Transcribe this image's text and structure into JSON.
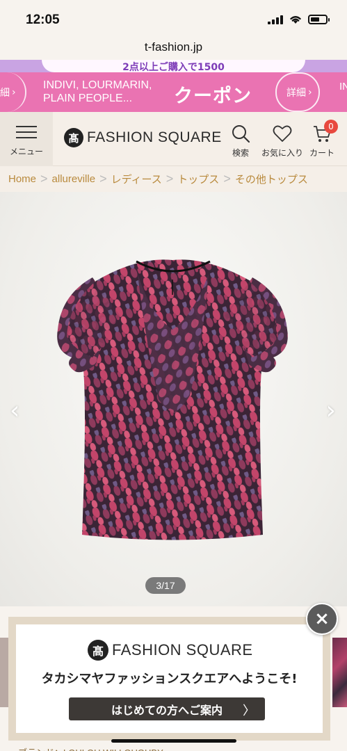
{
  "status": {
    "time": "12:05"
  },
  "browser": {
    "url": "t-fashion.jp"
  },
  "promo_top": {
    "text": "2点以上ご購入で1500"
  },
  "coupon": {
    "left_label": "細",
    "brands_line1": "INDIVI, LOURMARIN,",
    "brands_line2": "PLAIN PEOPLE...",
    "title": "クーポン",
    "detail": "詳細",
    "right_label": "IN"
  },
  "header": {
    "menu_label": "メニュー",
    "logo_mark": "髙",
    "logo_text": "FASHION SQUARE",
    "search_label": "検索",
    "favorites_label": "お気に入り",
    "cart_label": "カート",
    "cart_count": "0"
  },
  "breadcrumb": [
    "Home",
    "allureville",
    "レディース",
    "トップス",
    "その他トップス"
  ],
  "gallery": {
    "counter": "3/17",
    "prev": "‹",
    "next": "›"
  },
  "welcome": {
    "logo_mark": "髙",
    "logo_text": "FASHION SQUARE",
    "message": "タカシマヤファッションスクエアへようこそ!",
    "button": "はじめての方へご案内",
    "button_chevron": "〉"
  },
  "close": "×",
  "brand_line": "ブランド：LOULOU WILLOUGHBY",
  "colors": {
    "coupon_pink": "#ea73b2",
    "crumb_gold": "#b98a3d",
    "badge_red": "#e8493f",
    "promo_purple": "#c9a4e3"
  },
  "icons": [
    "hamburger-icon",
    "search-icon",
    "heart-icon",
    "cart-icon",
    "wifi-icon",
    "battery-icon",
    "signal-icon",
    "close-icon"
  ]
}
